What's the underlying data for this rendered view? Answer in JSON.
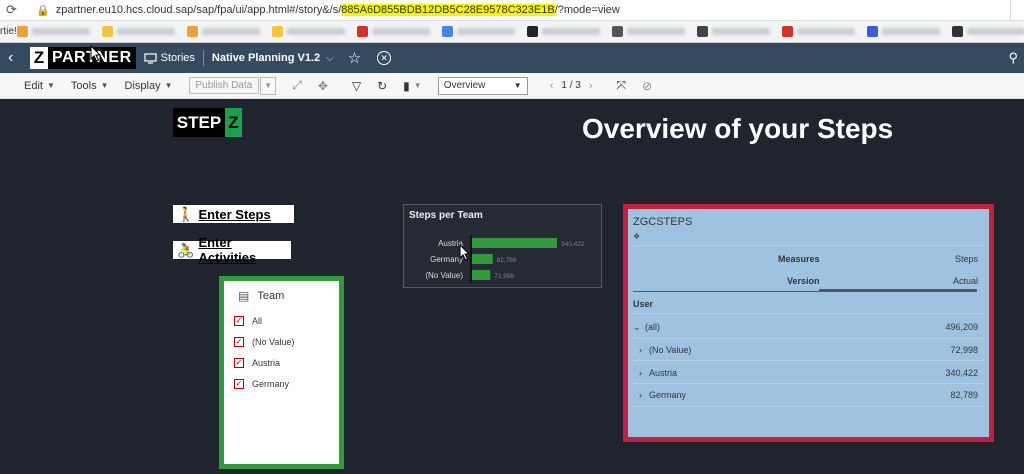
{
  "browser": {
    "url_prefix": "zpartner.eu10.hcs.cloud.sap/sap/fpa/ui/app.html#/story&/s/",
    "url_highlight": "885A6D855BDB12DB5C28E9578C323E1B",
    "url_suffix": "/?mode=view",
    "bookmarks_label": "rtie!",
    "bookmark_colors": [
      "#e8a33d",
      "#f4c542",
      "#e8a33d",
      "#f4c542",
      "#d93025",
      "#4285f4",
      "#222222",
      "#555555",
      "#444444",
      "#d93025",
      "#3b5bdb",
      "#333333"
    ]
  },
  "shell": {
    "logo_z": "Z",
    "logo_text": "PARTNER",
    "stories_label": "Stories",
    "story_name": "Native Planning V1.2"
  },
  "toolbar": {
    "edit": "Edit",
    "tools": "Tools",
    "display": "Display",
    "publish_data": "Publish Data",
    "page_select": "Overview",
    "page_indicator": "1 / 3"
  },
  "canvas": {
    "step_logo_step": "STEP",
    "step_logo_z": "Z",
    "title": "Overview of your Steps",
    "enter_steps": "Enter Steps",
    "enter_activities": "Enter Activities"
  },
  "team_filter": {
    "header": "Team",
    "items": [
      "All",
      "(No Value)",
      "Austria",
      "Germany"
    ]
  },
  "chart_data": {
    "type": "bar",
    "orientation": "horizontal",
    "title": "Steps per Team",
    "categories": [
      "Austria",
      "Germany",
      "(No Value)"
    ],
    "values": [
      340422,
      82789,
      72998
    ],
    "value_labels": [
      "340,422",
      "82,789",
      "72,998"
    ],
    "color": "#2f9b3d"
  },
  "table": {
    "title": "ZGCSTEPS",
    "measures_label": "Measures",
    "steps_label": "Steps",
    "version_label": "Version",
    "actual_label": "Actual",
    "user_label": "User",
    "rows": [
      {
        "label": "(all)",
        "value": "496,209"
      },
      {
        "label": "(No Value)",
        "value": "72,998"
      },
      {
        "label": "Austria",
        "value": "340,422"
      },
      {
        "label": "Germany",
        "value": "82,789"
      }
    ]
  }
}
